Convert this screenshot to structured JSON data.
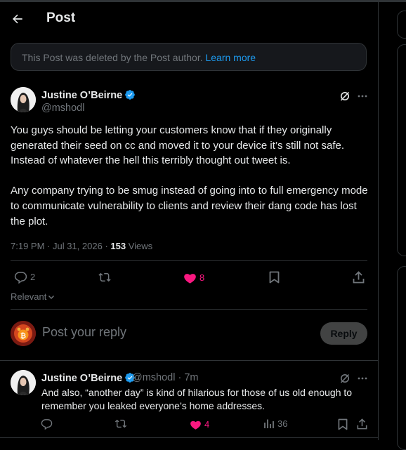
{
  "header": {
    "title": "Post"
  },
  "deleted_notice": {
    "text": "This Post was deleted by the Post author.",
    "link": "Learn more"
  },
  "post": {
    "author_name": "Justine O’Beirne",
    "author_handle": "@mshodl",
    "paragraphs": [
      "You guys should be letting your customers know that if they originally generated their seed on cc and moved it to your device it’s still not safe. Instead of whatever the hell this terribly thought out tweet is.",
      "Any company trying to be smug instead of going into to full emergency mode to communicate vulnerability to clients and review their dang code has lost the plot."
    ],
    "timestamp": "7:19 PM · Jul 31, 2026",
    "separator": "·",
    "views_count": "153",
    "views_label": "Views",
    "actions": {
      "replies": "2",
      "reposts": "",
      "likes": "8"
    },
    "liked": true
  },
  "sort": {
    "label": "Relevant"
  },
  "composer": {
    "placeholder": "Post your reply",
    "button": "Reply"
  },
  "reply": {
    "author_name": "Justine O’Beirne",
    "author_handle": "@mshodl",
    "time": "· 7m",
    "text": "And also, “another day” is kind of hilarious for those of us old enough to remember you leaked everyone’s home addresses.",
    "actions": {
      "replies": "",
      "reposts": "",
      "likes": "4",
      "views": "36"
    },
    "liked": true
  },
  "colors": {
    "accent": "#1d9bf0",
    "like": "#f91880",
    "text": "#e7e9ea",
    "muted": "#71767b",
    "border": "#2f3336"
  }
}
